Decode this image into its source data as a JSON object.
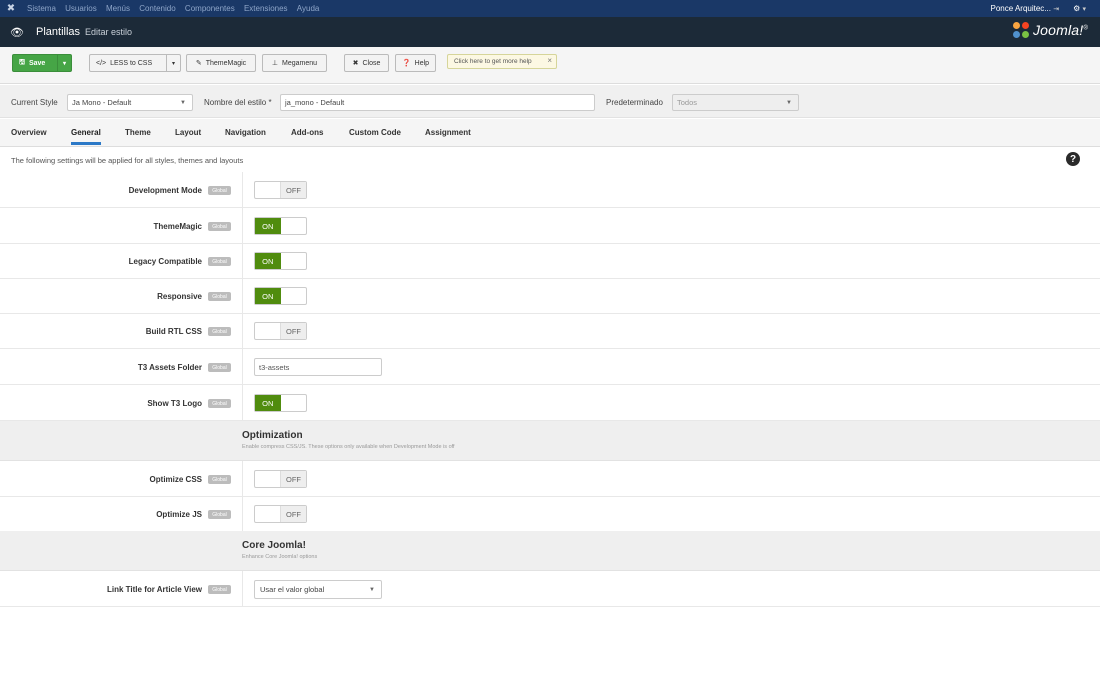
{
  "topnav": {
    "menu": [
      "Sistema",
      "Usuarios",
      "Menús",
      "Contenido",
      "Componentes",
      "Extensiones",
      "Ayuda"
    ],
    "user": "Ponce Arquitec...",
    "icons": [
      "joomla-icon",
      "external-link-icon",
      "gear-icon"
    ]
  },
  "header": {
    "title": "Plantillas",
    "subtitle": "Editar estilo",
    "brand": "Joomla!",
    "brand_mark": "®"
  },
  "toolbar": {
    "save": "Save",
    "less_to_css": "LESS to CSS",
    "thememagic": "ThemeMagic",
    "megamenu": "Megamenu",
    "close": "Close",
    "help": "Help",
    "hint": "Click here to get more help"
  },
  "style_row": {
    "current_style_label": "Current Style",
    "current_style_value": "Ja Mono - Default",
    "style_name_label": "Nombre del estilo *",
    "style_name_value": "ja_mono - Default",
    "default_label": "Predeterminado",
    "default_value": "Todos"
  },
  "tabs": [
    "Overview",
    "General",
    "Theme",
    "Layout",
    "Navigation",
    "Add-ons",
    "Custom Code",
    "Assignment"
  ],
  "active_tab": "General",
  "info_text": "The following settings will be applied for all styles, themes and layouts",
  "global_badge": "Global",
  "toggle_labels": {
    "on": "ON",
    "off": "OFF"
  },
  "settings": [
    {
      "label": "Development Mode",
      "type": "toggle",
      "state": "off"
    },
    {
      "label": "ThemeMagic",
      "type": "toggle",
      "state": "on"
    },
    {
      "label": "Legacy Compatible",
      "type": "toggle",
      "state": "on"
    },
    {
      "label": "Responsive",
      "type": "toggle",
      "state": "on"
    },
    {
      "label": "Build RTL CSS",
      "type": "toggle",
      "state": "off"
    },
    {
      "label": "T3 Assets Folder",
      "type": "text",
      "value": "t3-assets"
    },
    {
      "label": "Show T3 Logo",
      "type": "toggle",
      "state": "on"
    }
  ],
  "optimization": {
    "title": "Optimization",
    "desc": "Enable compress CSS/JS. These options only available when Development Mode is off",
    "settings": [
      {
        "label": "Optimize CSS",
        "type": "toggle",
        "state": "off"
      },
      {
        "label": "Optimize JS",
        "type": "toggle",
        "state": "off"
      }
    ]
  },
  "core": {
    "title": "Core Joomla!",
    "desc": "Enhance Core Joomla! options",
    "settings": [
      {
        "label": "Link Title for Article View",
        "type": "select",
        "value": "Usar el valor global"
      }
    ]
  },
  "colors": {
    "topnav": "#1a3867",
    "header": "#1c2a38",
    "save_green": "#46a546",
    "toggle_on": "#508c0e",
    "tab_active": "#2c79c7"
  }
}
